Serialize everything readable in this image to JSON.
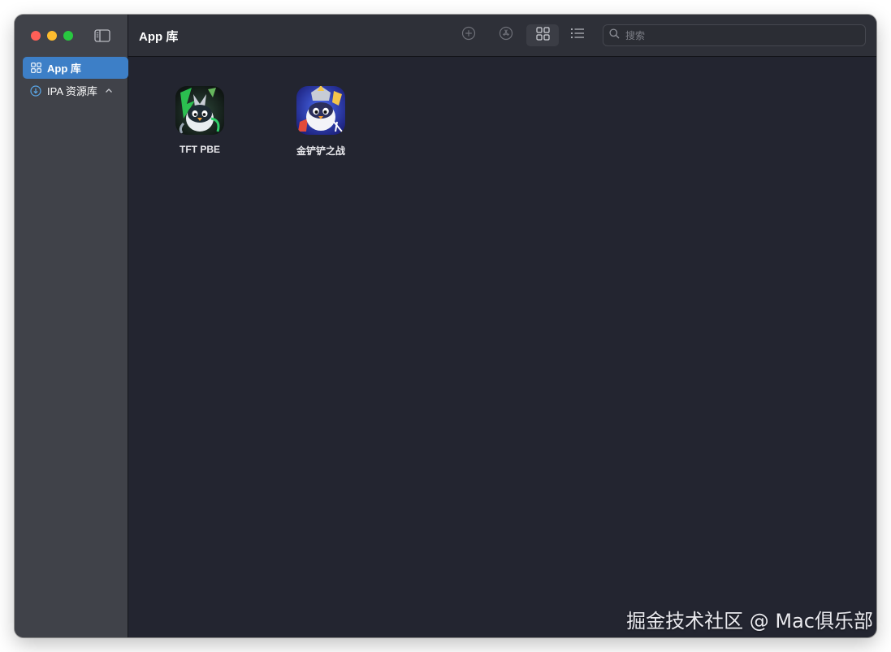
{
  "sidebar": {
    "items": [
      {
        "label": "App 库",
        "icon": "grid-icon",
        "active": true
      },
      {
        "label": "IPA 资源库",
        "icon": "download-circle-icon",
        "expanded": true
      }
    ]
  },
  "toolbar": {
    "title": "App 库",
    "buttons": [
      "add-circle-icon",
      "appstore-icon",
      "grid-view-icon",
      "list-view-icon"
    ],
    "search": {
      "placeholder": "搜索",
      "value": ""
    }
  },
  "apps": [
    {
      "name": "TFT PBE",
      "icon": "tft-pbe-app-icon"
    },
    {
      "name": "金铲铲之战",
      "icon": "jinchanchan-app-icon"
    }
  ],
  "watermark": "掘金技术社区 @ Mac俱乐部",
  "colors": {
    "accent": "#3d7fc7",
    "sidebar_bg": "#404249",
    "content_bg": "#232530",
    "toolbar_bg": "#2e3038"
  }
}
